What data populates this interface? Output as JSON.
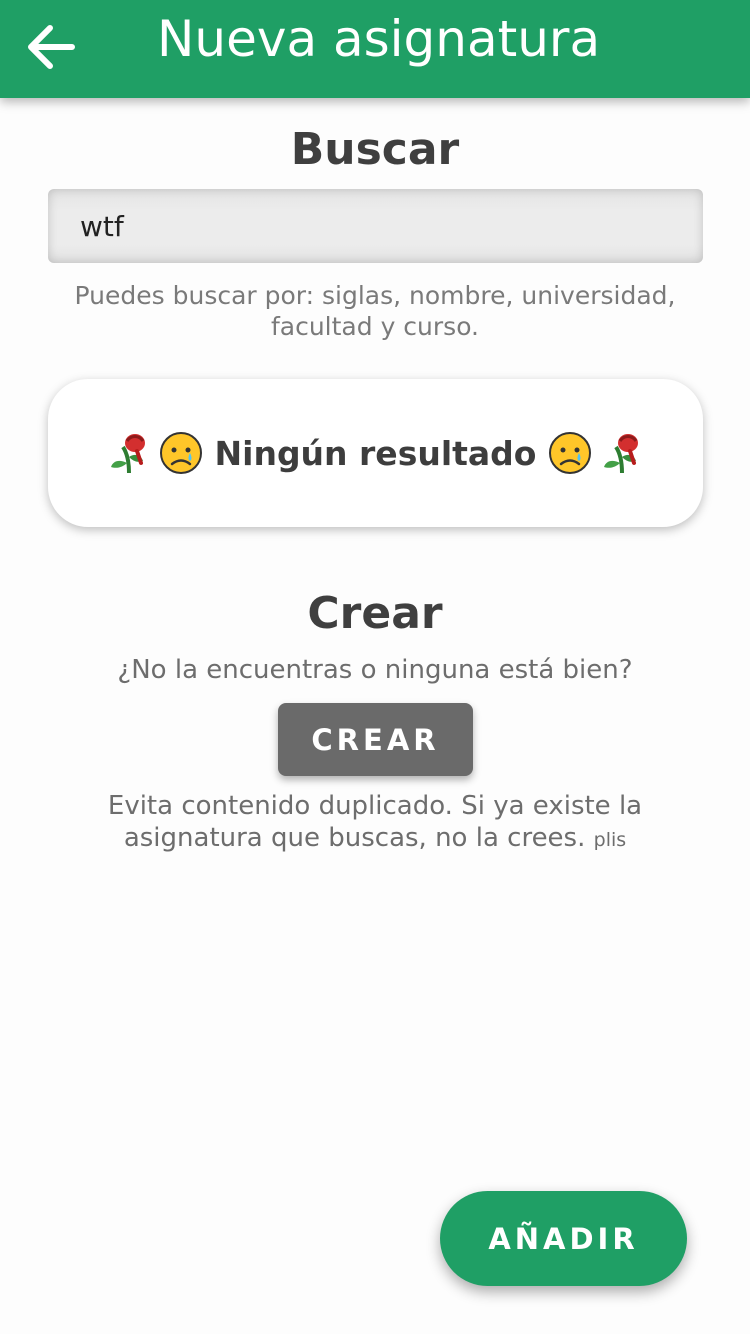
{
  "header": {
    "title": "Nueva asignatura",
    "back_icon": "arrow-left-icon",
    "background": "#1f9f65"
  },
  "search": {
    "title": "Buscar",
    "value": "wtf",
    "placeholder": "",
    "hint": "Puedes buscar por: siglas, nombre, universidad, facultad y curso."
  },
  "result": {
    "text": "Ningún resultado",
    "left_icons": [
      "wilted-flower-icon",
      "crying-face-icon"
    ],
    "right_icons": [
      "crying-face-icon",
      "wilted-flower-icon"
    ]
  },
  "create": {
    "title": "Crear",
    "question": "¿No la encuentras o ninguna está bien?",
    "button_label": "CREAR",
    "note": "Evita contenido duplicado. Si ya existe la asignatura que buscas, no la crees.",
    "note_small": "plis"
  },
  "fab": {
    "label": "AÑADIR",
    "color": "#1f9f65"
  }
}
